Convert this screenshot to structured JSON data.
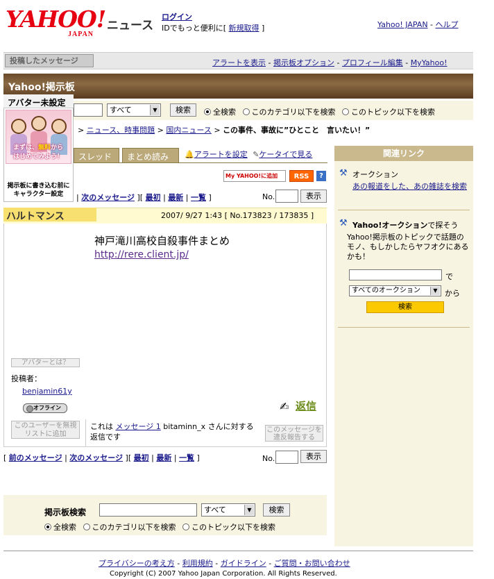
{
  "header": {
    "logo": "YAHOO!",
    "logo_sub": "JAPAN",
    "section": "ニュース",
    "login": "ログイン",
    "id_text": "IDでもっと便利に[ ",
    "signup": "新規取得",
    "id_close": " ]",
    "yj": "Yahoo! JAPAN",
    "sep": " - ",
    "help": "ヘルプ"
  },
  "nav": {
    "tab": "投稿したメッセージ",
    "links": [
      "アラートを表示",
      "掲示板オプション",
      "プロフィール編集",
      "MyYahoo!"
    ],
    "sep": " - "
  },
  "board": {
    "title": "Yahoo!掲示板"
  },
  "search": {
    "scope": "すべて",
    "button": "検索",
    "radio": [
      "全検索",
      "このカテゴリ以下を検索",
      "このトピック以下を検索"
    ]
  },
  "avatar": {
    "title": "アバター未設定",
    "promo1": "まずは、",
    "promo2": "無料",
    "promo3": "から",
    "promo4": "はじめてみよう！",
    "footer": "掲示板に書き込む前にキャラクター設定"
  },
  "breadcrumb": {
    "items": [
      "ニュース、時事問題",
      "国内ニュース"
    ],
    "current": "この事件、事故に”ひとこと　言いたい！”",
    "arrow": " > "
  },
  "tabs": {
    "thread": "スレッド",
    "summary": "まとめ読み",
    "alert": "アラートを設定",
    "mobile": "ケータイで見る"
  },
  "badges": {
    "myyahoo": "My YAHOO!に追加",
    "rss": "RSS",
    "help": "?"
  },
  "msgnav": {
    "prev": "前のメッセージ",
    "next": "次のメッセージ",
    "first": "最初",
    "latest": "最新",
    "list": "一覧",
    "no": "No.",
    "show": "表示",
    "ob": "[ ",
    "cb": " ]",
    "bar": " | "
  },
  "message": {
    "name": "ハルトマンス",
    "date": "2007/ 9/27 1:43",
    "num": "[ No.173823 / 173835 ]",
    "title": "神戸滝川高校自殺事件まとめ",
    "url": "http://rere.client.jp/"
  },
  "poster": {
    "avatar_q": "アバターとは？",
    "label": "投稿者：",
    "name": "benjamin61y",
    "status": "オフライン",
    "ignore": "このユーザーを無視リストに追加"
  },
  "reply": {
    "label": "返信",
    "pre": "これは ",
    "link": "メッセージ 1",
    "post": " bitaminn_x さんに対する返信です",
    "report": "このメッセージを違反報告する"
  },
  "right": {
    "head": "関連リンク",
    "auction": "オークション",
    "auction_link": "あの報道をした、あの雑誌を検索",
    "search_title": "Yahoo!オークション",
    "search_suffix": "で探そう",
    "desc": "Yahoo!掲示板のトピックで話題のモノ、もしかしたらヤフオクにあるかも！",
    "de": "で",
    "scope": "すべてのオークション",
    "kara": "から",
    "button": "検索"
  },
  "bottom": {
    "label": "掲示板検索"
  },
  "footer": {
    "links": [
      "プライバシーの考え方",
      "利用規約",
      "ガイドライン",
      "ご質問・お問い合わせ"
    ],
    "copyright": "Copyright (C) 2007 Yahoo Japan Corporation. All Rights Reserved."
  }
}
